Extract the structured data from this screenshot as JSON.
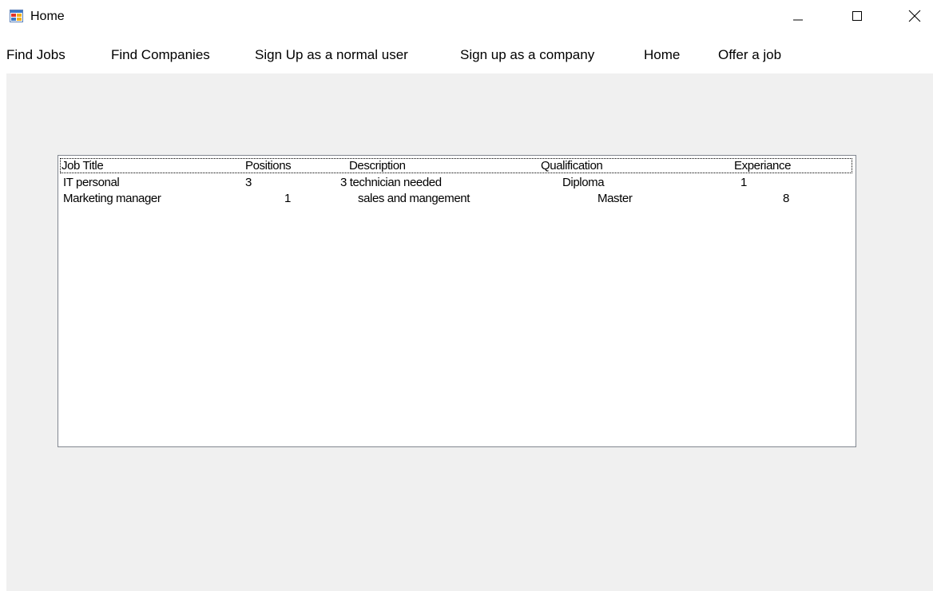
{
  "window": {
    "title": "Home",
    "icon": "windows-form-icon",
    "controls": {
      "minimize": "minimize-icon",
      "maximize": "maximize-icon",
      "close": "close-icon"
    }
  },
  "menu": {
    "items": [
      {
        "label": "Find Jobs"
      },
      {
        "label": "Find Companies"
      },
      {
        "label": "Sign Up as a normal user"
      },
      {
        "label": "Sign up as a company"
      },
      {
        "label": "Home"
      },
      {
        "label": "Offer a job"
      }
    ]
  },
  "list": {
    "columns": [
      "Job Title",
      "Positions",
      "Description",
      "Qualification",
      "Experiance"
    ],
    "rows": [
      [
        "IT personal",
        "3",
        "3 technician needed",
        "Diploma",
        "1"
      ],
      [
        "Marketing manager",
        "1",
        "sales and mangement",
        "Master",
        "8"
      ]
    ]
  }
}
